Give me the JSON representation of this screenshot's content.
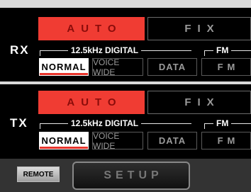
{
  "rx": {
    "label": "RX",
    "auto_label": "AUTO",
    "fix_label": "FIX",
    "digital_group_label": "12.5kHz DIGITAL",
    "fm_group_label": "FM",
    "options": [
      "NORMAL",
      "VOICE WIDE",
      "DATA",
      "FM"
    ],
    "selected": "NORMAL"
  },
  "tx": {
    "label": "TX",
    "auto_label": "AUTO",
    "fix_label": "FIX",
    "digital_group_label": "12.5kHz DIGITAL",
    "fm_group_label": "FM",
    "options": [
      "NORMAL",
      "VOICE WIDE",
      "DATA",
      "FM"
    ],
    "selected": "NORMAL"
  },
  "bottom": {
    "remote_label": "REMOTE",
    "setup_label": "SETUP"
  },
  "colors": {
    "accent_red": "#f03c33",
    "background": "#000000",
    "frame": "#d9d9d9"
  }
}
